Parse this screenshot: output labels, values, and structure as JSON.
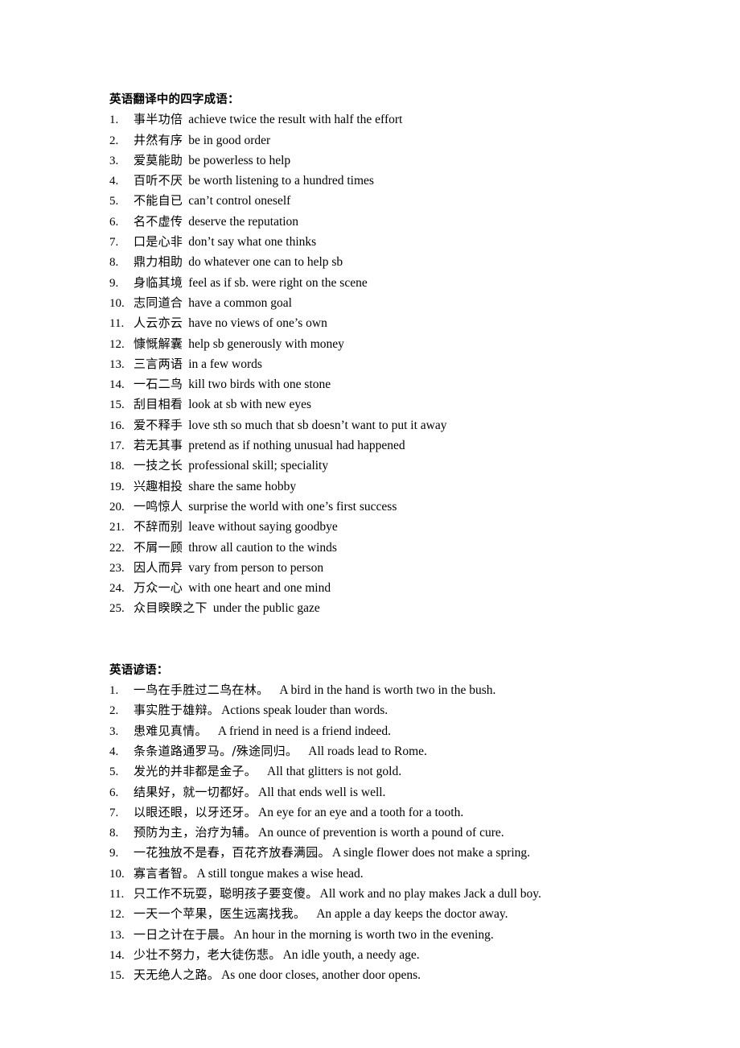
{
  "document": {
    "background_color": "#ffffff",
    "text_color": "#000000"
  },
  "sections": [
    {
      "heading": "英语翻译中的四字成语：",
      "kind": "idioms",
      "items": [
        {
          "num": "1.",
          "cn": "事半功倍",
          "en": "achieve twice the result with half the effort"
        },
        {
          "num": "2.",
          "cn": "井然有序",
          "en": "be in good order"
        },
        {
          "num": "3.",
          "cn": "爱莫能助",
          "en": "be powerless to help"
        },
        {
          "num": "4.",
          "cn": "百听不厌",
          "en": "be worth listening to a hundred times"
        },
        {
          "num": "5.",
          "cn": "不能自已",
          "en": "can’t control oneself"
        },
        {
          "num": "6.",
          "cn": "名不虚传",
          "en": "deserve the reputation"
        },
        {
          "num": "7.",
          "cn": "口是心非",
          "en": "don’t say what one thinks"
        },
        {
          "num": "8.",
          "cn": "鼎力相助",
          "en": "do whatever one can to help sb"
        },
        {
          "num": "9.",
          "cn": "身临其境",
          "en": "feel as if sb. were right on the scene"
        },
        {
          "num": "10.",
          "cn": "志同道合",
          "en": "have a common goal"
        },
        {
          "num": "11.",
          "cn": "人云亦云",
          "en": "have no views of one’s own"
        },
        {
          "num": "12.",
          "cn": "慷慨解囊",
          "en": "help sb generously with money"
        },
        {
          "num": "13.",
          "cn": "三言两语",
          "en": "in a few words"
        },
        {
          "num": "14.",
          "cn": "一石二鸟",
          "en": "kill two birds with one stone"
        },
        {
          "num": "15.",
          "cn": "刮目相看",
          "en": "look at sb with new eyes"
        },
        {
          "num": "16.",
          "cn": "爱不释手",
          "en": "love sth so much that sb doesn’t want to put it away"
        },
        {
          "num": "17.",
          "cn": "若无其事",
          "en": "pretend as if nothing unusual had happened"
        },
        {
          "num": "18.",
          "cn": "一技之长",
          "en": "professional skill; speciality"
        },
        {
          "num": "19.",
          "cn": "兴趣相投",
          "en": "share the same hobby"
        },
        {
          "num": "20.",
          "cn": "一鸣惊人",
          "en": "surprise the world with one’s first success"
        },
        {
          "num": "21.",
          "cn": "不辞而别",
          "en": "leave without saying goodbye"
        },
        {
          "num": "22.",
          "cn": "不屑一顾",
          "en": "throw all caution to the winds"
        },
        {
          "num": "23.",
          "cn": "因人而异",
          "en": "vary from person to person"
        },
        {
          "num": "24.",
          "cn": "万众一心",
          "en": "with one heart and one mind"
        },
        {
          "num": "25.",
          "cn": "众目睽睽之下",
          "en": "under the public gaze"
        }
      ]
    },
    {
      "heading": "英语谚语：",
      "kind": "proverbs",
      "items": [
        {
          "num": "1.",
          "cn": "一鸟在手胜过二鸟在林。",
          "en": "A bird in the hand is worth two in the bush.",
          "wide_gap": true
        },
        {
          "num": "2.",
          "cn": "事实胜于雄辩。",
          "en": "Actions speak louder than words.",
          "wide_gap": false
        },
        {
          "num": "3.",
          "cn": "患难见真情。",
          "en": "A friend in need is a friend indeed.",
          "wide_gap": true
        },
        {
          "num": "4.",
          "cn": "条条道路通罗马。/殊途同归。",
          "en": "All roads lead to Rome.",
          "wide_gap": true
        },
        {
          "num": "5.",
          "cn": "发光的并非都是金子。",
          "en": "All that glitters is not gold.",
          "wide_gap": true
        },
        {
          "num": "6.",
          "cn": "结果好，就一切都好。",
          "en": "All that ends well is well.",
          "wide_gap": false
        },
        {
          "num": "7.",
          "cn": "以眼还眼，以牙还牙。",
          "en": "An eye for an eye and a tooth for a tooth.",
          "wide_gap": false
        },
        {
          "num": "8.",
          "cn": "预防为主，治疗为辅。",
          "en": "An ounce of prevention is worth a pound of cure.",
          "wide_gap": false
        },
        {
          "num": "9.",
          "cn": "一花独放不是春，百花齐放春满园。",
          "en": "A single flower does not make a spring.",
          "wide_gap": false
        },
        {
          "num": "10.",
          "cn": "寡言者智。",
          "en": "A still tongue makes a wise head.",
          "wide_gap": false
        },
        {
          "num": "11.",
          "cn": "只工作不玩耍，聪明孩子要变傻。",
          "en": "All work and no play makes Jack a dull boy.",
          "wide_gap": false
        },
        {
          "num": "12.",
          "cn": "一天一个苹果，医生远离找我。",
          "en": "An apple a day keeps the doctor away.",
          "wide_gap": true
        },
        {
          "num": "13.",
          "cn": "一日之计在于晨。",
          "en": "An hour in the morning is worth two in the evening.",
          "wide_gap": false
        },
        {
          "num": "14.",
          "cn": "少壮不努力，老大徒伤悲。",
          "en": "An idle youth, a needy age.",
          "wide_gap": false
        },
        {
          "num": "15.",
          "cn": "天无绝人之路。",
          "en": "As one door closes, another door opens.",
          "wide_gap": false
        }
      ]
    }
  ]
}
